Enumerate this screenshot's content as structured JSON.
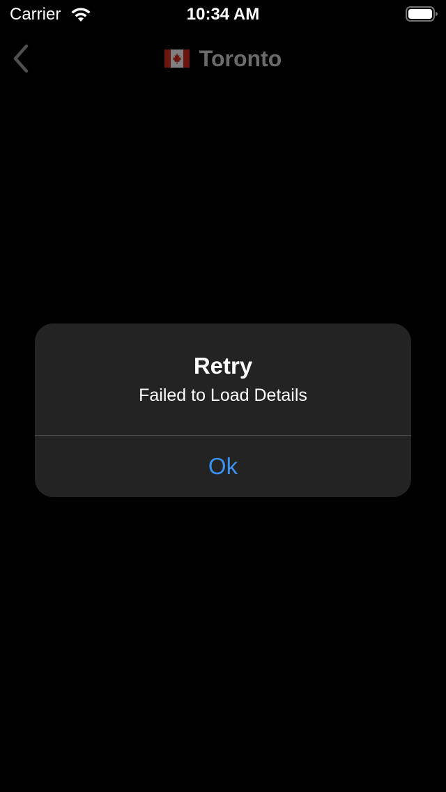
{
  "status_bar": {
    "carrier": "Carrier",
    "time": "10:34 AM",
    "wifi_icon": "wifi-icon",
    "battery_icon": "battery-full-icon"
  },
  "nav_bar": {
    "back_icon": "chevron-left-icon",
    "flag_icon": "canada-flag-icon",
    "title": "Toronto"
  },
  "alert": {
    "title": "Retry",
    "message": "Failed to Load Details",
    "button_label": "Ok"
  },
  "colors": {
    "background": "#000000",
    "alert_background": "#232323",
    "accent": "#3a8ff0",
    "dimmed_title": "#6b6b6b",
    "flag_red": "#d52b1e"
  }
}
